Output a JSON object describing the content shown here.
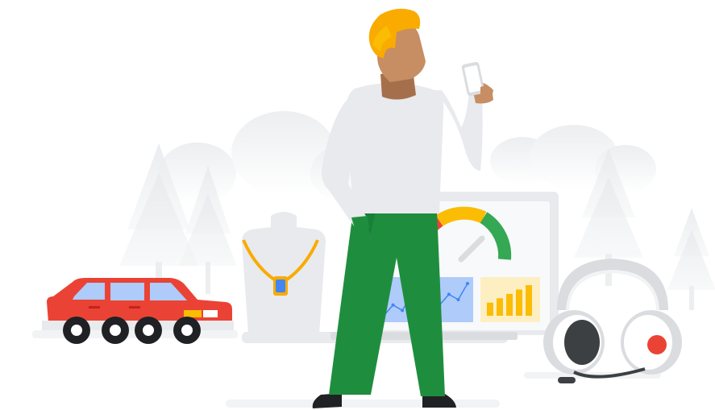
{
  "illustration": {
    "elements": [
      {
        "id": "background-trees",
        "icon": "pine-tree-icon"
      },
      {
        "id": "background-clouds",
        "icon": "cloud-icon"
      },
      {
        "id": "red-car",
        "icon": "car-icon"
      },
      {
        "id": "necklace-bust",
        "icon": "necklace-icon"
      },
      {
        "id": "laptop-dashboard",
        "icon": "laptop-icon"
      },
      {
        "id": "gauge",
        "icon": "gauge-icon"
      },
      {
        "id": "line-chart-panel",
        "icon": "line-chart-icon"
      },
      {
        "id": "bar-chart-panel",
        "icon": "bar-chart-icon"
      },
      {
        "id": "headphones",
        "icon": "headset-icon"
      },
      {
        "id": "person-with-phone",
        "icon": "person-icon"
      }
    ],
    "gauge_level": 0.62,
    "bar_chart_values": [
      3,
      4,
      5,
      6,
      7
    ],
    "line_chart_points": [
      2,
      4,
      3,
      6,
      5,
      7,
      4,
      6,
      5,
      8
    ],
    "colors": {
      "google_blue": "#4285F4",
      "google_red": "#EA4335",
      "google_yellow": "#FBBC04",
      "google_green": "#34A853",
      "green_pants": "#1E8E3E",
      "skin": "#C68E62",
      "hair": "#F9AB00",
      "light_gray": "#E8EAED",
      "mid_gray": "#DADCE0"
    }
  }
}
